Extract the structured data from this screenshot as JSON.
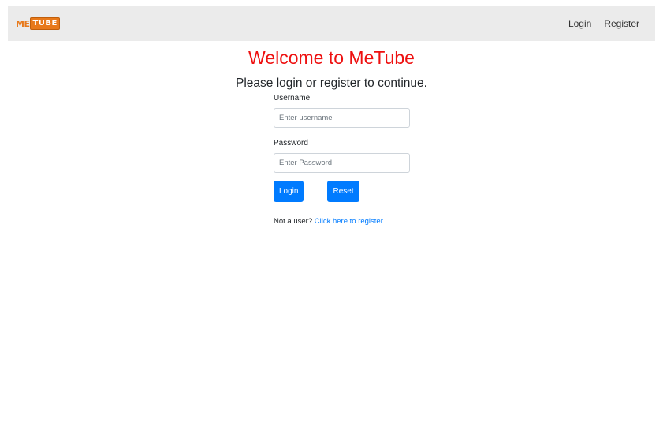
{
  "navbar": {
    "logo_me": "ME",
    "logo_tube": "TUBE",
    "links": [
      {
        "label": "Login"
      },
      {
        "label": "Register"
      }
    ]
  },
  "main": {
    "title": "Welcome to MeTube",
    "subtitle": "Please login or register to continue."
  },
  "form": {
    "username_label": "Username",
    "username_placeholder": "Enter username",
    "username_value": "",
    "password_label": "Password",
    "password_placeholder": "Enter Password",
    "password_value": "",
    "login_button": "Login",
    "reset_button": "Reset",
    "register_prompt": "Not a user?",
    "register_link": "Click here to register"
  },
  "colors": {
    "title": "#ee1111",
    "primary": "#007bff",
    "navbar_bg": "#ebebeb",
    "logo_orange": "#e8791a"
  }
}
